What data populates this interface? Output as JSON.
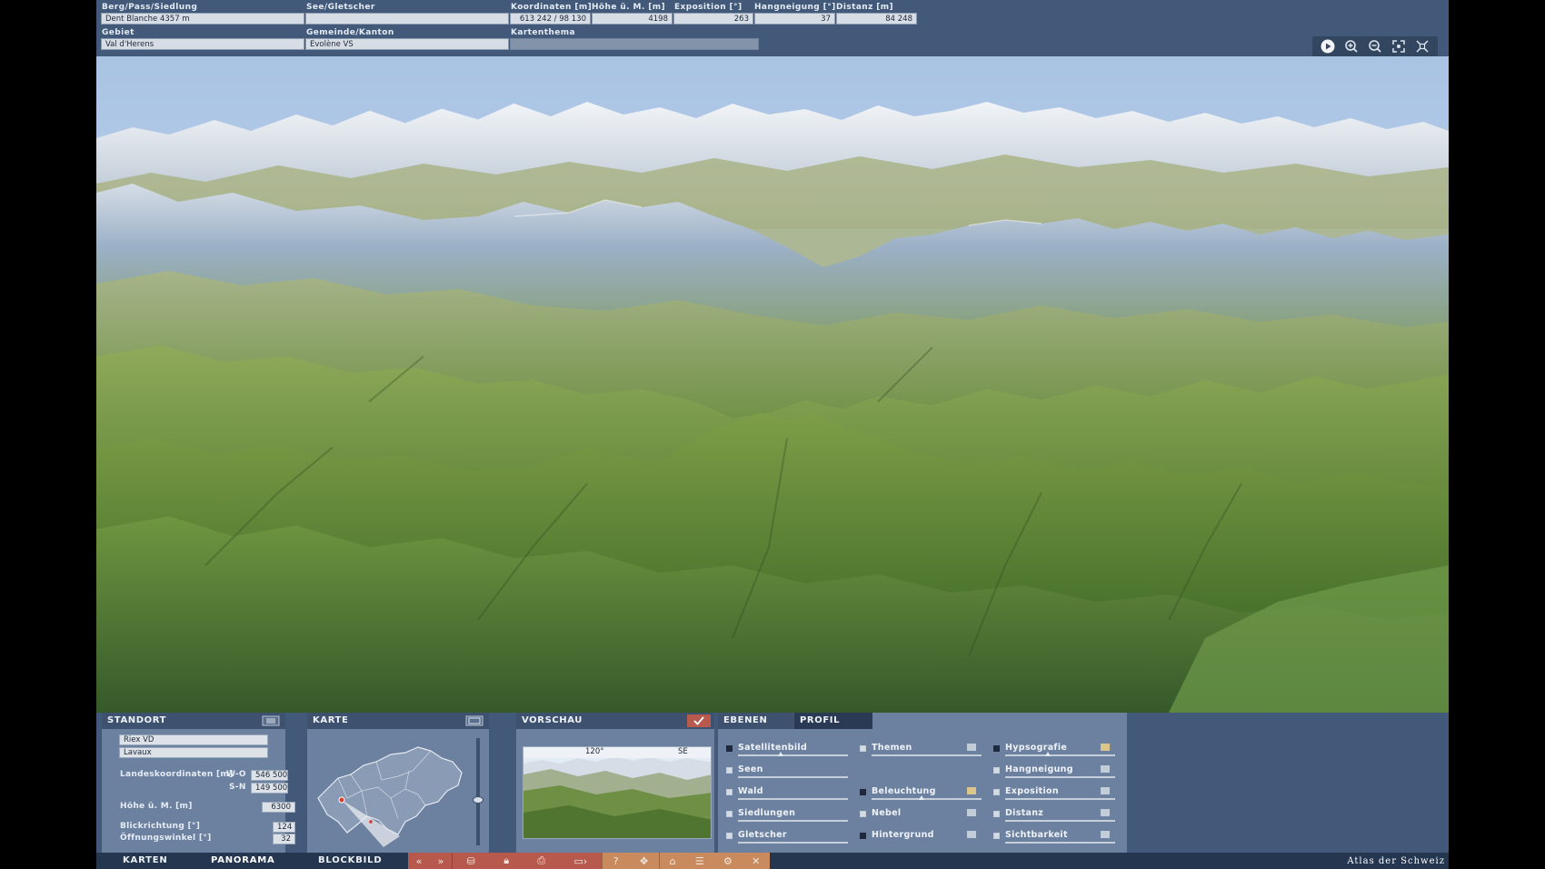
{
  "top": {
    "fields_row1": [
      {
        "label": "Berg/Pass/Siedlung",
        "value": "Dent Blanche   4357 m"
      },
      {
        "label": "See/Gletscher",
        "value": ""
      },
      {
        "label": "Koordinaten [m]",
        "value": "613 242 / 98 130"
      },
      {
        "label": "Höhe ü. M. [m]",
        "value": "4198"
      },
      {
        "label": "Exposition [°]",
        "value": "263"
      },
      {
        "label": "Hangneigung [°]",
        "value": "37"
      },
      {
        "label": "Distanz [m]",
        "value": "84 248"
      }
    ],
    "fields_row2": [
      {
        "label": "Gebiet",
        "value": "Val d'Herens"
      },
      {
        "label": "Gemeinde/Kanton",
        "value": "Evolène   VS"
      },
      {
        "label": "Kartenthema",
        "value": ""
      }
    ],
    "view_controls": [
      {
        "name": "play-icon"
      },
      {
        "name": "zoom-in-icon"
      },
      {
        "name": "zoom-out-icon"
      },
      {
        "name": "zoom-extent-icon"
      },
      {
        "name": "fullscreen-icon"
      }
    ]
  },
  "standort": {
    "title": "STANDORT",
    "place": "Riex   VD",
    "region": "Lavaux",
    "coords_label": "Landeskoordinaten [m]",
    "wo_label": "W-O",
    "wo_value": "546 500",
    "sn_label": "S-N",
    "sn_value": "149 500",
    "height_label": "Höhe ü. M. [m]",
    "height_value": "6300",
    "direction_label": "Blickrichtung [°]",
    "direction_value": "124",
    "angle_label": "Öffnungswinkel [°]",
    "angle_value": "32"
  },
  "karte": {
    "title": "KARTE",
    "height_slider": 0.38
  },
  "vorschau": {
    "title": "VORSCHAU",
    "angle_label": "120°",
    "dir_label": "SE"
  },
  "ebenen": {
    "tabs": [
      "EBENEN",
      "PROFIL"
    ],
    "col1": [
      {
        "label": "Satellitenbild",
        "checked": true,
        "slider": 0.4
      },
      {
        "label": "Seen",
        "checked": false
      },
      {
        "label": "Wald",
        "checked": false
      },
      {
        "label": "Siedlungen",
        "checked": false
      },
      {
        "label": "Gletscher",
        "checked": false
      }
    ],
    "col2": [
      {
        "label": "Themen",
        "checked": false
      },
      {
        "label": "Beleuchtung",
        "checked": true,
        "slider": 0.45
      },
      {
        "label": "Nebel",
        "checked": false
      },
      {
        "label": "Hintergrund",
        "checked": true
      }
    ],
    "col3": [
      {
        "label": "Hypsografie",
        "checked": true,
        "slider": 0.4
      },
      {
        "label": "Hangneigung",
        "checked": false
      },
      {
        "label": "Exposition",
        "checked": false
      },
      {
        "label": "Distanz",
        "checked": false
      },
      {
        "label": "Sichtbarkeit",
        "checked": false
      }
    ]
  },
  "nav": {
    "tabs": [
      "KARTEN",
      "PANORAMA",
      "BLOCKBILD"
    ],
    "active": "PANORAMA",
    "brand": "Atlas der Schweiz"
  },
  "colors": {
    "app_bg": "#43597a",
    "panel_bg": "#6c80a0",
    "toolbar_red": "#b75a4d",
    "toolbar_orange": "#c98a5e"
  }
}
